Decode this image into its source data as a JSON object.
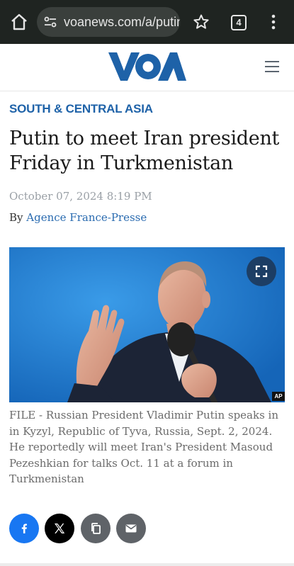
{
  "browser": {
    "url": "voanews.com/a/putin",
    "tab_count": "4",
    "icons": [
      "home-icon",
      "site-settings-icon",
      "star-icon",
      "tabs-icon",
      "more-vert-icon"
    ]
  },
  "site": {
    "logo_text": "VOA",
    "brand_color": "#1e62a8"
  },
  "article": {
    "category": "SOUTH & CENTRAL ASIA",
    "headline": "Putin to meet Iran president Friday in Turkmenistan",
    "date": "October 07, 2024 8:19 PM",
    "byline_prefix": "By",
    "author": "Agence France-Presse",
    "photo_credit": "AP",
    "caption": "FILE - Russian President Vladimir Putin speaks in in Kyzyl, Republic of Tyva, Russia, Sept. 2, 2024. He reportedly will meet Iran's President Masoud Pezeshkian for talks Oct. 11 at a forum in Turkmenistan"
  },
  "share": {
    "buttons": [
      {
        "name": "facebook",
        "color": "#1877f2"
      },
      {
        "name": "x",
        "color": "#000000"
      },
      {
        "name": "copy-link",
        "color": "#5f6368"
      },
      {
        "name": "email",
        "color": "#5f6368"
      }
    ]
  }
}
